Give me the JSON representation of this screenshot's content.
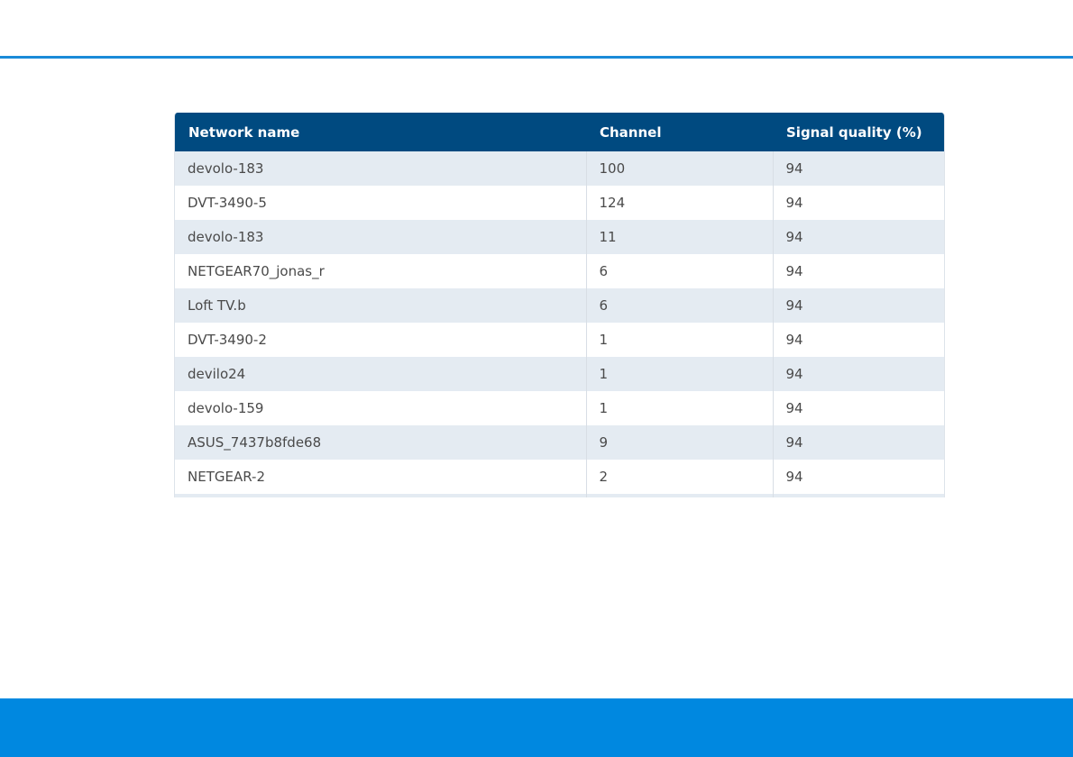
{
  "table": {
    "headers": [
      "Network name",
      "Channel",
      "Signal quality (%)"
    ],
    "rows": [
      [
        "devolo-183",
        "100",
        "94"
      ],
      [
        "DVT-3490-5",
        "124",
        "94"
      ],
      [
        "devolo-183",
        "11",
        "94"
      ],
      [
        "NETGEAR70_jonas_r",
        "6",
        "94"
      ],
      [
        "Loft TV.b",
        "6",
        "94"
      ],
      [
        "DVT-3490-2",
        "1",
        "94"
      ],
      [
        "devilo24",
        "1",
        "94"
      ],
      [
        "devolo-159",
        "1",
        "94"
      ],
      [
        "ASUS_7437b8fde68",
        "9",
        "94"
      ],
      [
        "NETGEAR-2",
        "2",
        "94"
      ],
      [
        "",
        "",
        ""
      ]
    ]
  },
  "colors": {
    "header_bg": "#004a80",
    "stripe_bg": "#e4ebf2",
    "accent_rule": "#1a8ad8",
    "footer_bar": "#0088e0"
  }
}
